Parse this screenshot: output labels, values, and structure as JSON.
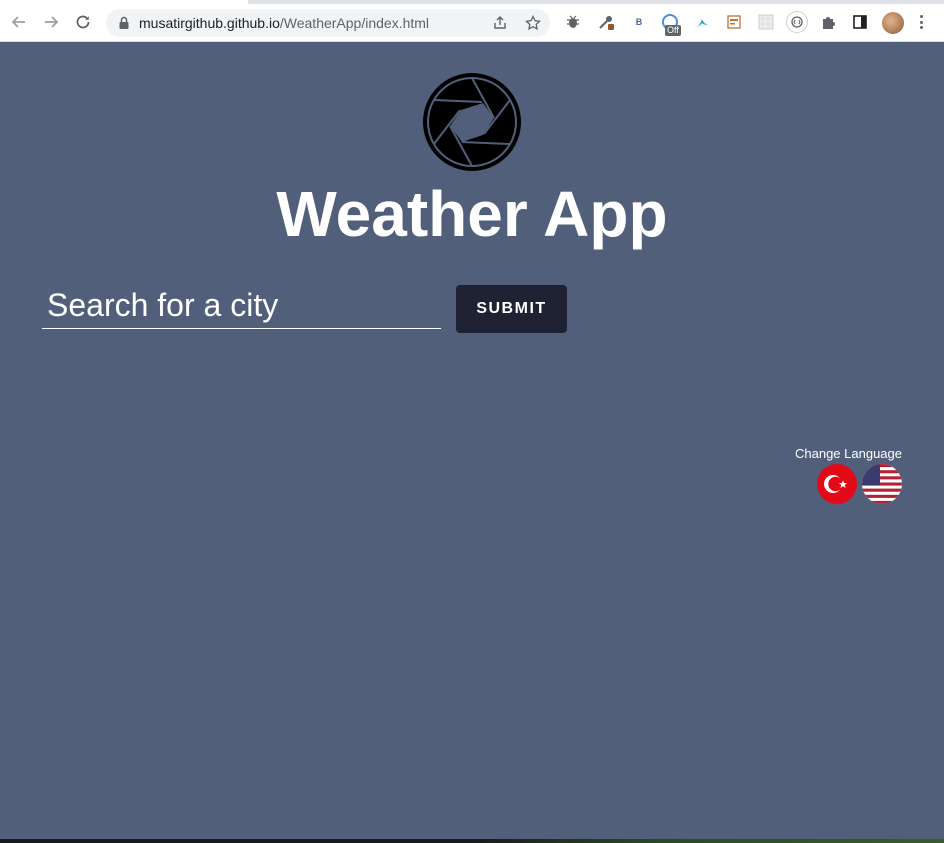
{
  "browser": {
    "url_host": "musatirgithub.github.io",
    "url_path": "/WeatherApp/index.html",
    "extension_badge": "Off",
    "extension_letter": "B",
    "icons": [
      "back-icon",
      "forward-icon",
      "reload-icon",
      "lock-icon",
      "share-icon",
      "bookmark-star-icon",
      "bug-extension-icon",
      "eyedropper-extension-icon",
      "b-extension-icon",
      "off-extension-icon",
      "bird-extension-icon",
      "window-extension-icon",
      "grid-extension-icon",
      "circle-extension-icon",
      "puzzle-extensions-icon",
      "side-panel-icon",
      "profile-avatar",
      "menu-icon"
    ]
  },
  "app": {
    "title": "Weather App",
    "search_placeholder": "Search for a city",
    "search_value": "",
    "submit_label": "SUBMIT",
    "change_language_label": "Change Language",
    "languages": [
      "turkish-flag",
      "us-flag"
    ]
  },
  "colors": {
    "page_background": "#525f7a",
    "submit_background": "#1e2233",
    "text": "#ffffff"
  }
}
